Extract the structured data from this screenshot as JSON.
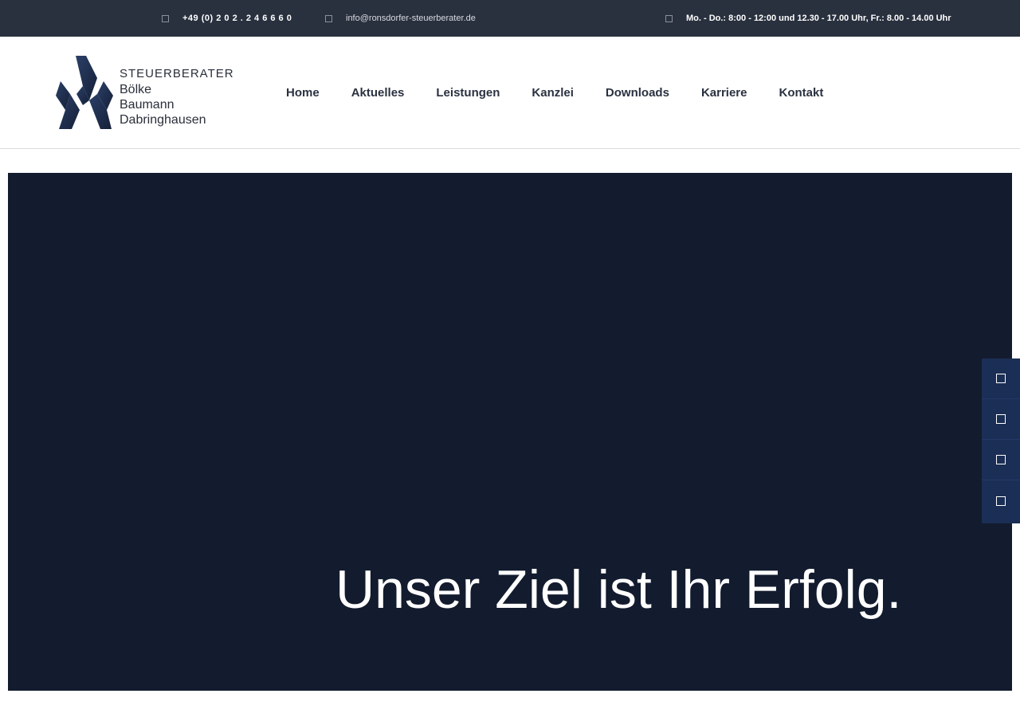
{
  "topbar": {
    "phone": "+49 (0) 2 0 2 . 2 4 6 6 6 0",
    "email": "info@ronsdorfer-steuerberater.de",
    "hours": "Mo. - Do.: 8:00 - 12:00 und 12.30 - 17.00 Uhr, Fr.: 8.00 - 14.00 Uhr"
  },
  "logo": {
    "line1": "STEUERBERATER",
    "line2": "Bölke",
    "line3": "Baumann",
    "line4": "Dabringhausen",
    "color": "#1f2b44"
  },
  "nav": {
    "items": [
      {
        "label": "Home"
      },
      {
        "label": "Aktuelles"
      },
      {
        "label": "Leistungen"
      },
      {
        "label": "Kanzlei"
      },
      {
        "label": "Downloads"
      },
      {
        "label": "Karriere"
      },
      {
        "label": "Kontakt"
      }
    ]
  },
  "hero": {
    "title": "Unser Ziel ist Ihr Erfolg.",
    "background": "#131c2e"
  },
  "side_widget": {
    "icons": [
      "square-icon",
      "square-icon",
      "square-icon",
      "square-icon"
    ]
  },
  "colors": {
    "topbar": "#29303e",
    "nav_text": "#2a3140",
    "side_widget": "#1b2e55"
  }
}
